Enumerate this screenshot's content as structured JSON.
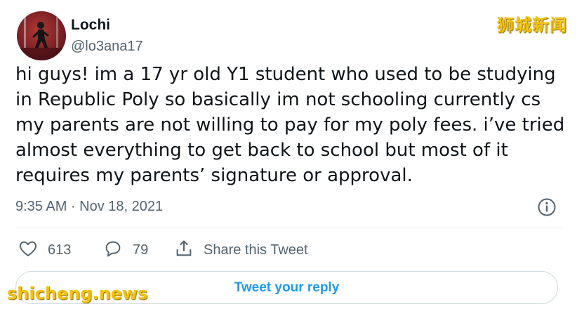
{
  "tweet": {
    "author_name": "Lochi",
    "author_handle": "@lo3ana17",
    "text": "hi guys! im a 17 yr old Y1 student who used to be studying in Republic Poly so basically im not schooling currently cs my parents are not willing to pay for my poly fees. i’ve tried almost everything to get back to school but most of it requires my parents’ signature or approval.",
    "timestamp": "9:35 AM · Nov 18, 2021",
    "likes": "613",
    "replies": "79",
    "share_label": "Share this Tweet",
    "reply_button_label": "Tweet your reply"
  },
  "icons": {
    "like": "heart-icon",
    "reply": "comment-icon",
    "share": "share-icon",
    "info": "info-icon"
  },
  "watermarks": {
    "top": "狮城新闻",
    "bottom": "shicheng.news"
  },
  "colors": {
    "accent": "#1d9bf0",
    "secondary_text": "#536471",
    "watermark": "#f4c20d"
  }
}
